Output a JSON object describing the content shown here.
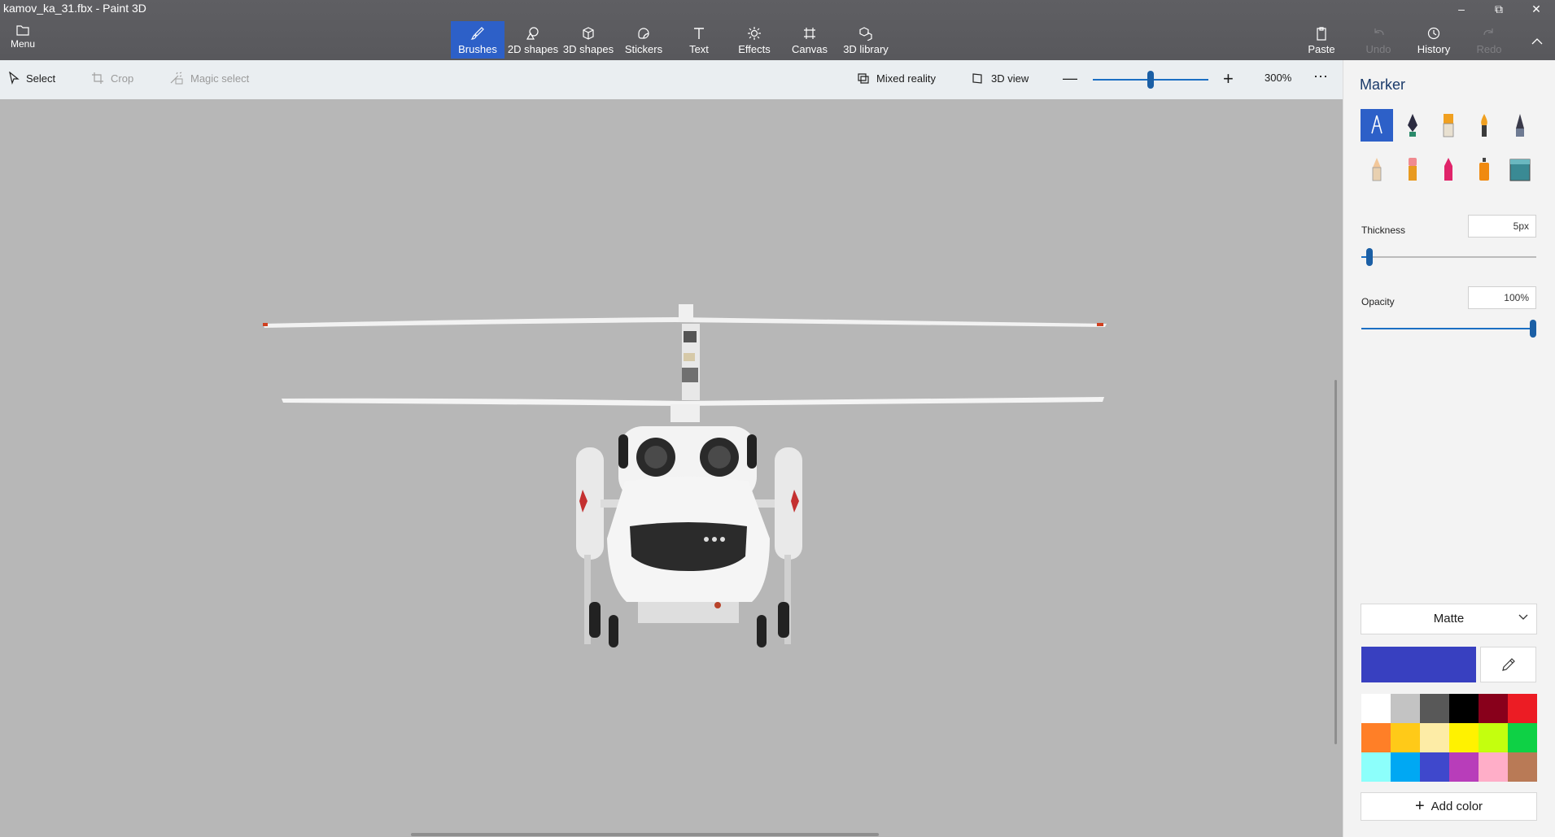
{
  "window": {
    "title": "kamov_ka_31.fbx - Paint 3D"
  },
  "ribbon": {
    "menu_label": "Menu",
    "tools": [
      {
        "label": "Brushes",
        "active": true
      },
      {
        "label": "2D shapes"
      },
      {
        "label": "3D shapes"
      },
      {
        "label": "Stickers"
      },
      {
        "label": "Text"
      },
      {
        "label": "Effects"
      },
      {
        "label": "Canvas"
      },
      {
        "label": "3D library"
      }
    ],
    "right": {
      "paste": "Paste",
      "undo": "Undo",
      "history": "History",
      "redo": "Redo"
    }
  },
  "toolbar": {
    "select": "Select",
    "crop": "Crop",
    "magic_select": "Magic select",
    "mixed_reality": "Mixed reality",
    "view_3d": "3D view",
    "zoom_value": "300%",
    "zoom_level_fraction": 0.5
  },
  "panel": {
    "title": "Marker",
    "brushes": [
      {
        "name": "Marker",
        "active": true
      },
      {
        "name": "Calligraphy pen"
      },
      {
        "name": "Oil brush"
      },
      {
        "name": "Watercolor"
      },
      {
        "name": "Pixel pen"
      },
      {
        "name": "Pencil"
      },
      {
        "name": "Eraser"
      },
      {
        "name": "Crayon"
      },
      {
        "name": "Spray can"
      },
      {
        "name": "Fill"
      }
    ],
    "thickness_label": "Thickness",
    "thickness_value": "5px",
    "thickness_level_fraction": 0.03,
    "opacity_label": "Opacity",
    "opacity_value": "100%",
    "opacity_level_fraction": 1.0,
    "finish": "Matte",
    "current_color": "#3840c0",
    "palette": [
      "#ffffff",
      "#c3c3c3",
      "#585858",
      "#000000",
      "#88001b",
      "#ec1c24",
      "#ff7f27",
      "#ffca18",
      "#fdeca6",
      "#fff200",
      "#c4ff0e",
      "#0ed145",
      "#8cfffb",
      "#00a8f3",
      "#3f48cc",
      "#b83dba",
      "#ffaec8",
      "#b97a56"
    ],
    "add_color": "Add color"
  },
  "accent_color": "#2d60c8"
}
